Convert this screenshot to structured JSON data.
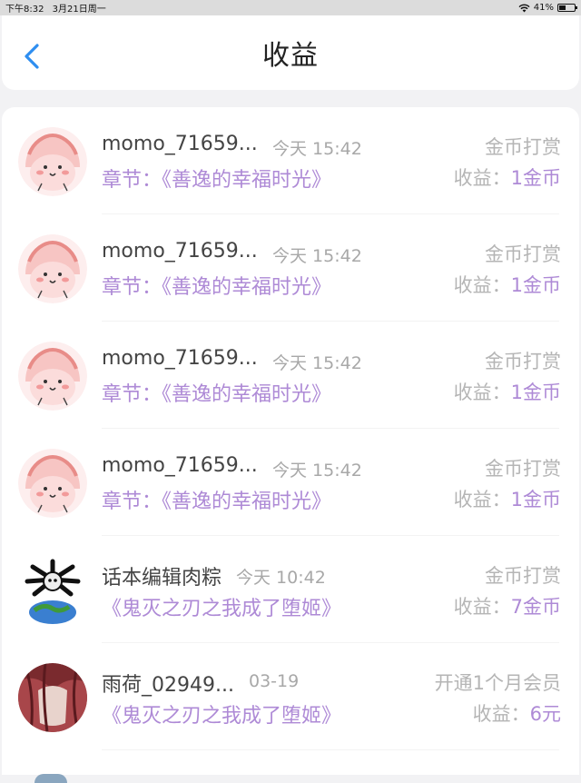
{
  "status_bar": {
    "time": "下午8:32",
    "date": "3月21日周一",
    "battery": "41%",
    "battery_level": 0.41
  },
  "header": {
    "title": "收益"
  },
  "earnings": [
    {
      "avatar": "pink-blob-avatar",
      "name": "momo_71659...",
      "time": "今天 15:42",
      "type": "金币打赏",
      "chapter": "章节：《善逸的幸福时光》",
      "earn_label": "收益：",
      "earn_value": "1金币"
    },
    {
      "avatar": "pink-blob-avatar",
      "name": "momo_71659...",
      "time": "今天 15:42",
      "type": "金币打赏",
      "chapter": "章节：《善逸的幸福时光》",
      "earn_label": "收益：",
      "earn_value": "1金币"
    },
    {
      "avatar": "pink-blob-avatar",
      "name": "momo_71659...",
      "time": "今天 15:42",
      "type": "金币打赏",
      "chapter": "章节：《善逸的幸福时光》",
      "earn_label": "收益：",
      "earn_value": "1金币"
    },
    {
      "avatar": "pink-blob-avatar",
      "name": "momo_71659...",
      "time": "今天 15:42",
      "type": "金币打赏",
      "chapter": "章节：《善逸的幸福时光》",
      "earn_label": "收益：",
      "earn_value": "1金币"
    },
    {
      "avatar": "skull-globe-avatar",
      "name": "话本编辑肉粽",
      "time": "今天 10:42",
      "type": "金币打赏",
      "chapter": "《鬼灭之刃之我成了堕姬》",
      "earn_label": "收益：",
      "earn_value": "7金币"
    },
    {
      "avatar": "red-hair-avatar",
      "name": "雨荷_02949...",
      "time": "03-19",
      "type": "开通1个月会员",
      "chapter": "《鬼灭之刃之我成了堕姬》",
      "earn_label": "收益：",
      "earn_value": "6元"
    }
  ]
}
